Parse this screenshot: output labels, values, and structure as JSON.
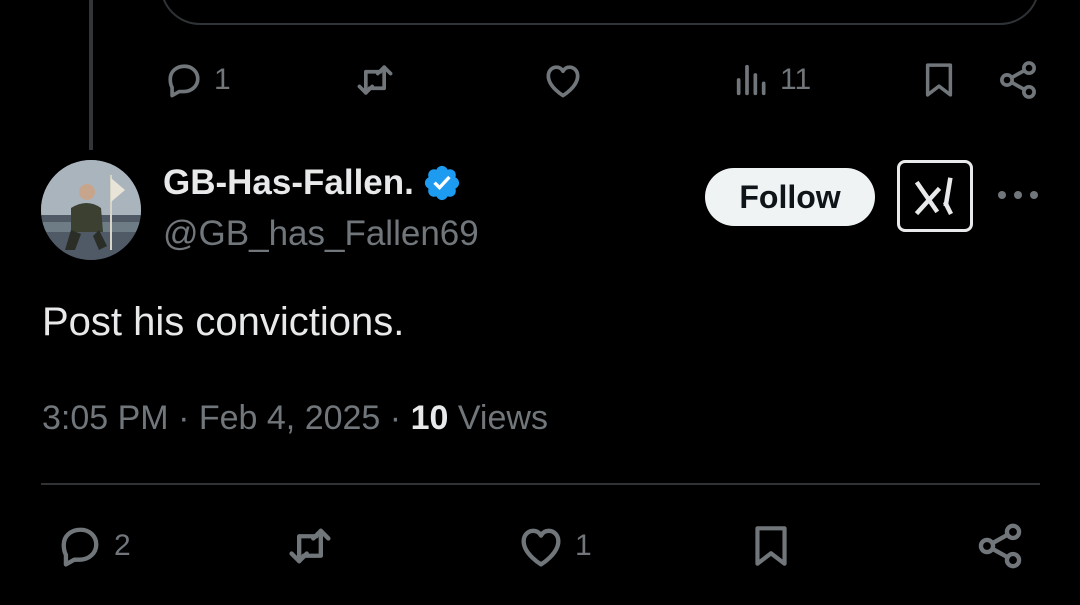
{
  "colors": {
    "background": "#000000",
    "primary_text": "#e7e9ea",
    "secondary_text": "#71767b",
    "divider": "#2f3336",
    "verified_blue": "#1d9bf0",
    "follow_bg": "#eff3f4"
  },
  "previous_post": {
    "actions": {
      "reply": {
        "icon": "reply-icon",
        "count": "1"
      },
      "repost": {
        "icon": "repost-icon",
        "count": ""
      },
      "like": {
        "icon": "heart-icon",
        "count": ""
      },
      "views": {
        "icon": "analytics-icon",
        "count": "11"
      },
      "bookmark": {
        "icon": "bookmark-icon"
      },
      "share": {
        "icon": "share-icon"
      }
    }
  },
  "post": {
    "author": {
      "display_name": "GB-Has-Fallen.",
      "handle": "@GB_has_Fallen69",
      "verified": true
    },
    "follow_label": "Follow",
    "grok_icon": "grok-icon",
    "more_icon": "more-icon",
    "text": "Post his convictions.",
    "time": "3:05 PM",
    "separator": "·",
    "date": "Feb 4, 2025",
    "views_count": "10",
    "views_label": "Views",
    "actions": {
      "reply": {
        "icon": "reply-icon",
        "count": "2"
      },
      "repost": {
        "icon": "repost-icon",
        "count": ""
      },
      "like": {
        "icon": "heart-icon",
        "count": "1"
      },
      "bookmark": {
        "icon": "bookmark-icon"
      },
      "share": {
        "icon": "share-icon"
      }
    }
  }
}
